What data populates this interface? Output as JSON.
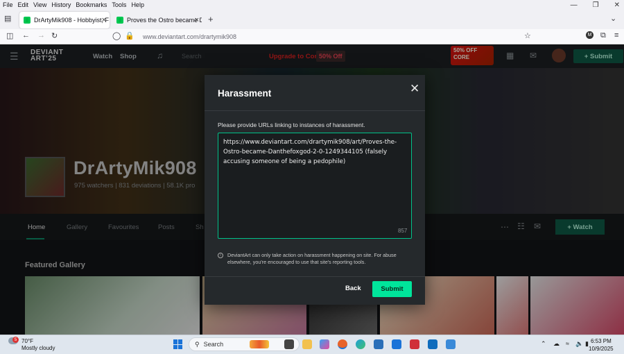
{
  "browser": {
    "menu": [
      "File",
      "Edit",
      "View",
      "History",
      "Bookmarks",
      "Tools",
      "Help"
    ],
    "tabs": [
      {
        "title": "DrArtyMik908 - Hobbyist, Filmm",
        "active": true
      },
      {
        "title": "Proves the Ostro became Danth",
        "active": false
      }
    ],
    "url": "www.deviantart.com/drartymik908"
  },
  "site": {
    "nav": [
      "Watch",
      "Shop"
    ],
    "search_placeholder": "Search",
    "upgrade_label": "Upgrade to Core",
    "discount_badge": "50% Off",
    "promo_text": "50% OFF CORE",
    "submit_label": "+ Submit",
    "accent_color": "#00e59b"
  },
  "profile": {
    "username": "DrArtyMik908",
    "stats": "975 watchers  |  831 deviations  |  58.1K pro",
    "tabs": [
      "Home",
      "Gallery",
      "Favourites",
      "Posts",
      "Sh"
    ],
    "watch_label": "+ Watch",
    "featured_heading": "Featured Gallery"
  },
  "modal": {
    "title": "Harassment",
    "close_icon": "close-icon",
    "prompt": "Please provide URLs linking to instances of harassment.",
    "urls_value": "https://www.deviantart.com/drartymik908/art/Proves-the-Ostro-became-Danthefoxgod-2-0-1249344105 (falsely accusing someone of being a pedophile)",
    "char_count": "857",
    "info_text": "DeviantArt can only take action on harassment happening on site. For abuse elsewhere, you're encouraged to use that site's reporting tools.",
    "back_label": "Back",
    "submit_label": "Submit"
  },
  "taskbar": {
    "weather_badge": "5",
    "temperature": "70°F",
    "weather": "Mostly cloudy",
    "search_label": "Search",
    "time": "6:53 PM",
    "date": "10/9/2025"
  }
}
